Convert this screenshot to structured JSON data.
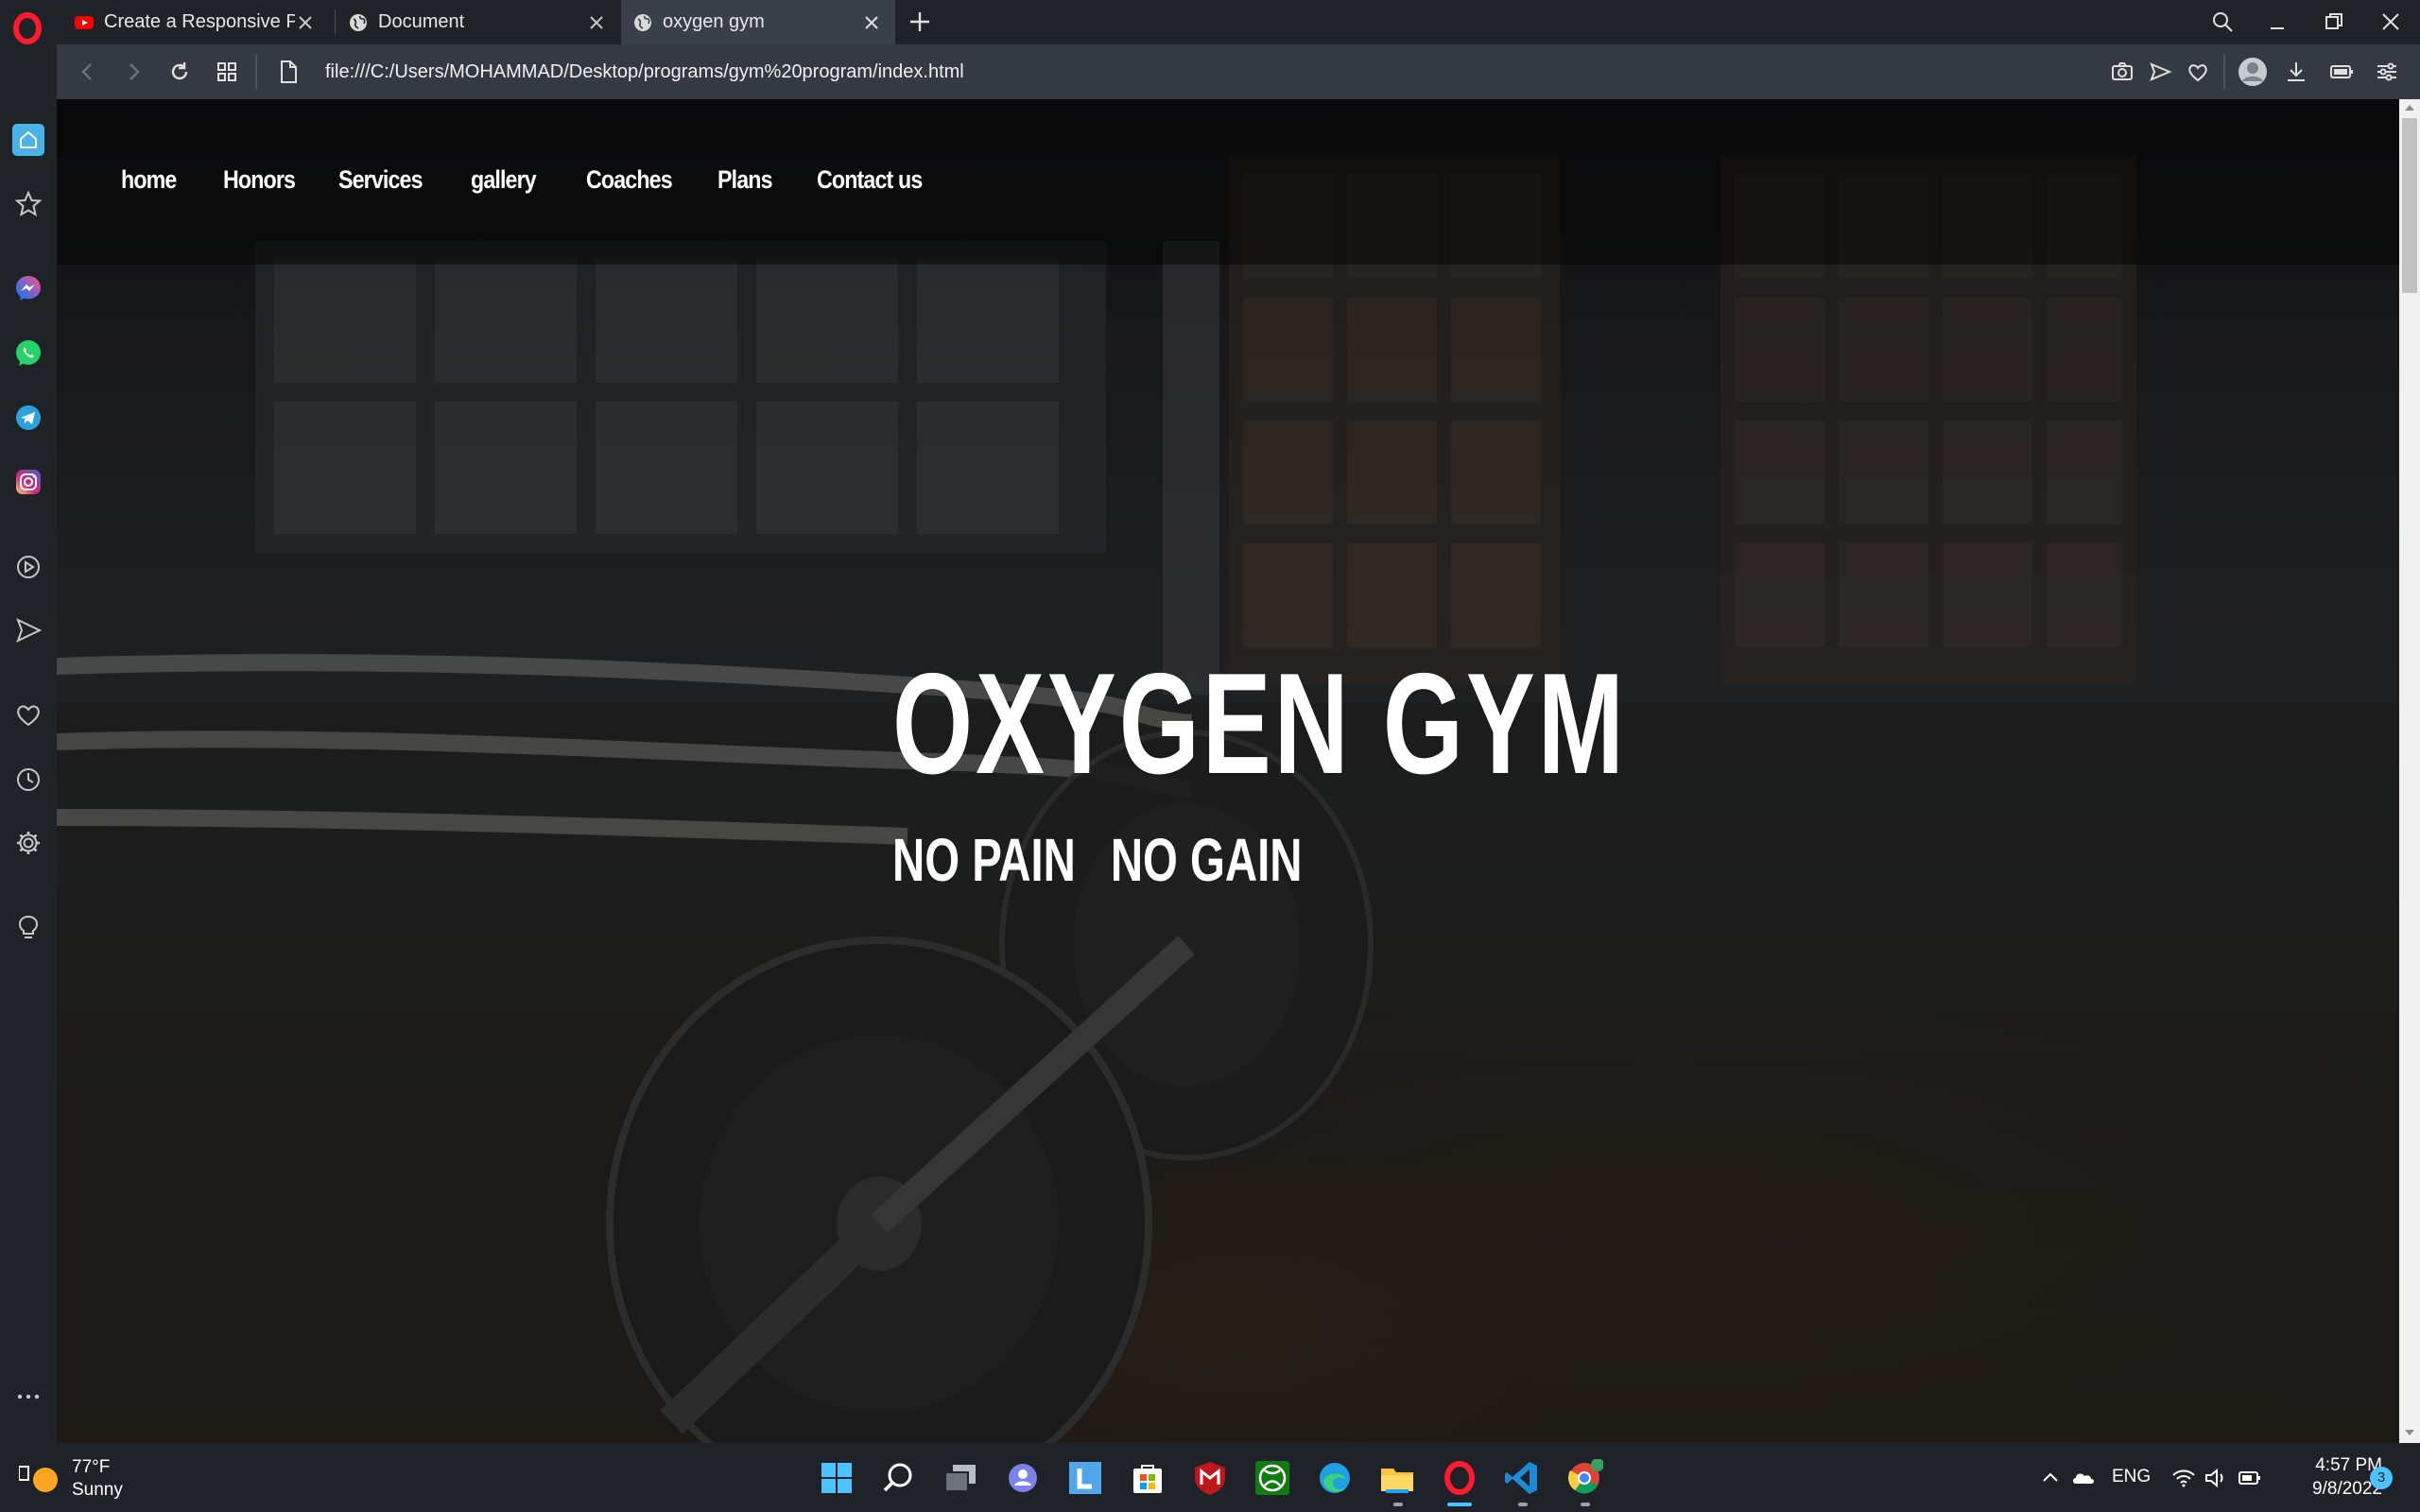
{
  "browser": {
    "tabs": [
      {
        "title": "Create a Responsive Person",
        "favicon": "youtube-icon",
        "active": false
      },
      {
        "title": "Document",
        "favicon": "globe-icon",
        "active": false
      },
      {
        "title": "oxygen gym",
        "favicon": "globe-icon",
        "active": true
      }
    ],
    "url": "file:///C:/Users/MOHAMMAD/Desktop/programs/gym%20program/index.html"
  },
  "sidebar": {
    "items": [
      "home-icon",
      "bookmarks-icon",
      "messenger-icon",
      "whatsapp-icon",
      "telegram-icon",
      "instagram-icon",
      "player-icon",
      "flow-icon",
      "heart-icon",
      "history-icon",
      "settings-icon",
      "lightbulb-icon",
      "more-icon"
    ]
  },
  "site": {
    "nav": [
      "home",
      "Honors",
      "Services",
      "gallery",
      "Coaches",
      "Plans",
      "Contact us"
    ],
    "hero_title": "OXYGEN GYM",
    "hero_sub_1": "NO PAIN",
    "hero_sub_2": "NO GAIN"
  },
  "taskbar": {
    "weather_temp": "77°F",
    "weather_cond": "Sunny",
    "lang": "ENG",
    "time": "4:57 PM",
    "date": "9/8/2022",
    "notifications": "3"
  },
  "colors": {
    "accent": "#4cc2ff",
    "opera_red": "#ff1b2d",
    "chrome_dark": "#1f2227",
    "addressbar": "#353943"
  }
}
